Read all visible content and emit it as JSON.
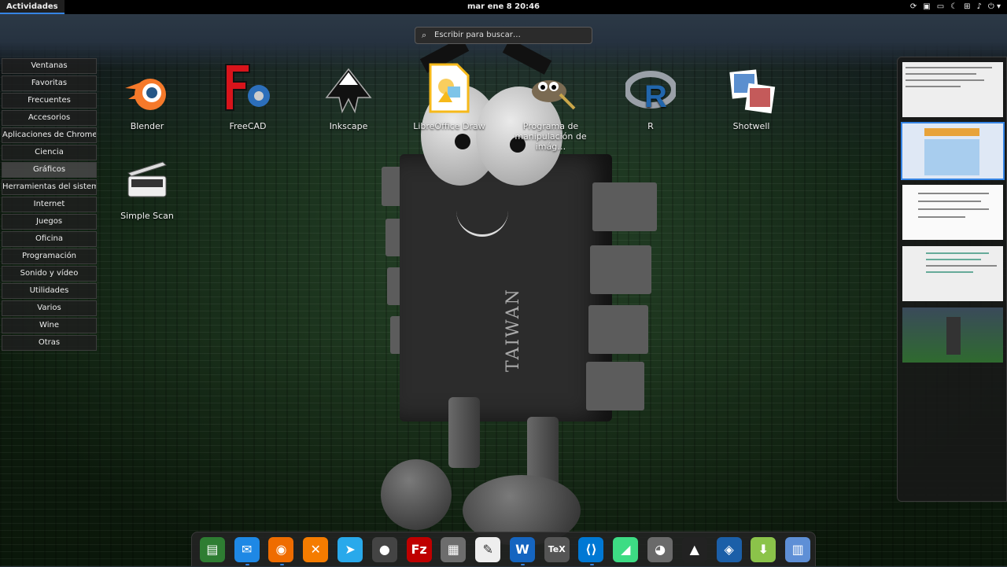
{
  "topbar": {
    "activities": "Actividades",
    "clock": "mar ene 8  20:46",
    "tray_icons": [
      "refresh-icon",
      "window-icon",
      "display-icon",
      "night-mode-icon",
      "network-icon",
      "volume-icon",
      "power-icon"
    ]
  },
  "search": {
    "placeholder": "Escribir para buscar…"
  },
  "categories": [
    "Ventanas",
    "Favoritas",
    "Frecuentes",
    "Accesorios",
    "Aplicaciones de Chrome",
    "Ciencia",
    "Gráficos",
    "Herramientas del sistema",
    "Internet",
    "Juegos",
    "Oficina",
    "Programación",
    "Sonido y vídeo",
    "Utilidades",
    "Varios",
    "Wine",
    "Otras"
  ],
  "active_category": "Gráficos",
  "apps": [
    {
      "name": "Blender",
      "icon": "blender-icon"
    },
    {
      "name": "FreeCAD",
      "icon": "freecad-icon"
    },
    {
      "name": "Inkscape",
      "icon": "inkscape-icon"
    },
    {
      "name": "LibreOffice Draw",
      "icon": "libreoffice-draw-icon"
    },
    {
      "name": "Programa de manipulación de imág…",
      "icon": "gimp-icon"
    },
    {
      "name": "R",
      "icon": "r-icon"
    },
    {
      "name": "Shotwell",
      "icon": "shotwell-icon"
    },
    {
      "name": "Simple Scan",
      "icon": "scanner-icon"
    }
  ],
  "wallpaper_text": "TAIWAN",
  "workspaces": 5,
  "active_workspace": 2,
  "dock": [
    {
      "name": "system-monitor-icon",
      "glyph": "▤",
      "color": "#2e7d32",
      "running": false
    },
    {
      "name": "thunderbird-icon",
      "glyph": "✉",
      "color": "#1e88e5",
      "running": true
    },
    {
      "name": "firefox-icon",
      "glyph": "◉",
      "color": "#ef6c00",
      "running": true
    },
    {
      "name": "crossover-icon",
      "glyph": "✕",
      "color": "#f57c00",
      "running": false
    },
    {
      "name": "telegram-icon",
      "glyph": "➤",
      "color": "#29a9eb",
      "running": false
    },
    {
      "name": "vlc-icon",
      "glyph": "●",
      "color": "#444444",
      "running": false
    },
    {
      "name": "filezilla-icon",
      "glyph": "Fz",
      "color": "#bf0000",
      "running": false
    },
    {
      "name": "calculator-icon",
      "glyph": "▦",
      "color": "#6d6d6d",
      "running": false
    },
    {
      "name": "text-editor-icon",
      "glyph": "✎",
      "color": "#eeeeee",
      "running": false
    },
    {
      "name": "writer-icon",
      "glyph": "W",
      "color": "#1565c0",
      "running": true
    },
    {
      "name": "texmaker-icon",
      "glyph": "TeX",
      "color": "#555555",
      "running": false
    },
    {
      "name": "vscode-icon",
      "glyph": "⟨⟩",
      "color": "#0078d4",
      "running": true
    },
    {
      "name": "android-studio-icon",
      "glyph": "◢",
      "color": "#3ddc84",
      "running": false
    },
    {
      "name": "gimp-dock-icon",
      "glyph": "◕",
      "color": "#6a6a6a",
      "running": false
    },
    {
      "name": "inkscape-dock-icon",
      "glyph": "▲",
      "color": "#222222",
      "running": false
    },
    {
      "name": "virtualbox-icon",
      "glyph": "◈",
      "color": "#1b5fa8",
      "running": false
    },
    {
      "name": "software-install-icon",
      "glyph": "⬇",
      "color": "#8bc34a",
      "running": false
    },
    {
      "name": "files-icon",
      "glyph": "▥",
      "color": "#5e8fd6",
      "running": false
    }
  ],
  "colors": {
    "accent": "#3584e4",
    "panel": "#000000"
  }
}
